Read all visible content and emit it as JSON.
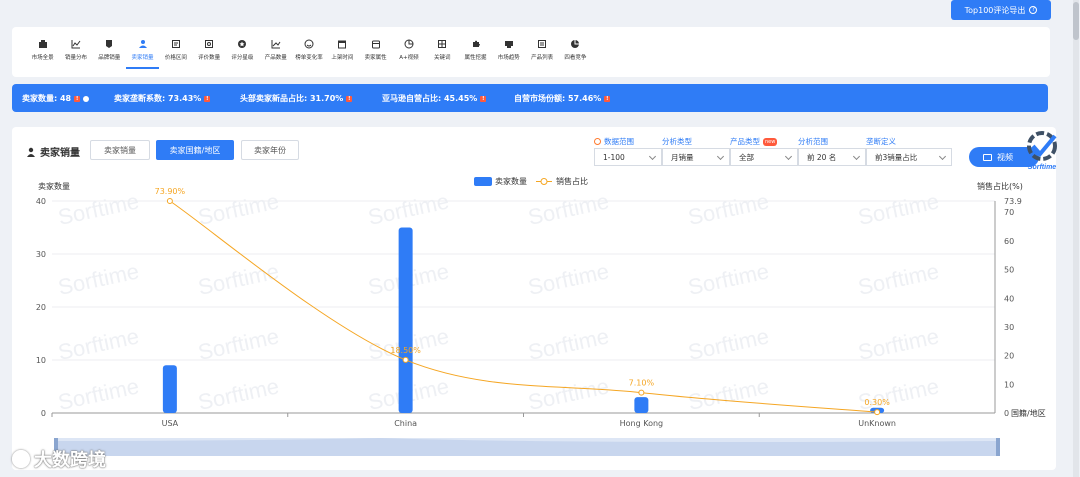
{
  "export_label": "Top100评论导出",
  "nav": [
    {
      "label": "市场全景",
      "icon": "market-icon"
    },
    {
      "label": "销量分布",
      "icon": "line-chart-icon"
    },
    {
      "label": "品牌销量",
      "icon": "brand-icon"
    },
    {
      "label": "卖家销量",
      "icon": "seller-icon",
      "active": true
    },
    {
      "label": "价格区间",
      "icon": "price-icon"
    },
    {
      "label": "评价数量",
      "icon": "review-icon"
    },
    {
      "label": "评分星级",
      "icon": "star-icon"
    },
    {
      "label": "产品数量",
      "icon": "trend-icon"
    },
    {
      "label": "榜单变化率",
      "icon": "smile-icon"
    },
    {
      "label": "上架时间",
      "icon": "calendar-icon"
    },
    {
      "label": "卖家属性",
      "icon": "store-icon"
    },
    {
      "label": "A+视频",
      "icon": "pie-icon"
    },
    {
      "label": "关键词",
      "icon": "keyword-icon"
    },
    {
      "label": "属性挖掘",
      "icon": "puzzle-icon"
    },
    {
      "label": "市场趋势",
      "icon": "trend-box-icon"
    },
    {
      "label": "产品列表",
      "icon": "list-icon"
    },
    {
      "label": "四看竞争",
      "icon": "compete-icon"
    }
  ],
  "stats": [
    {
      "text": "卖家数量: 48"
    },
    {
      "text": "卖家垄断系数: 73.43%"
    },
    {
      "text": "头部卖家新品占比: 31.70%"
    },
    {
      "text": "亚马逊自营占比: 45.45%"
    },
    {
      "text": "自营市场份额: 57.46%"
    }
  ],
  "panel": {
    "title": "卖家销量",
    "segments": [
      "卖家销量",
      "卖家国籍/地区",
      "卖家年份"
    ],
    "filters": [
      {
        "label": "数据范围",
        "value": "1-100"
      },
      {
        "label": "分析类型",
        "value": "月销量"
      },
      {
        "label": "产品类型",
        "value": "全部",
        "badge": "new"
      },
      {
        "label": "分析范围",
        "value": "前 20 名"
      },
      {
        "label": "垄断定义",
        "value": "前3销量占比"
      }
    ],
    "video_label": "视频",
    "logo_text": "Sorftime"
  },
  "watermark": "大数跨境",
  "watermark_bg": "Sorftime",
  "chart_data": {
    "type": "bar",
    "categories": [
      "USA",
      "China",
      "Hong Kong",
      "UnKnown"
    ],
    "x_axis_name": "国籍/地区",
    "series": [
      {
        "name": "卖家数量",
        "type": "bar",
        "axis": "left",
        "values": [
          9,
          35,
          3,
          1
        ],
        "color": "#2f7cf6"
      },
      {
        "name": "销售占比",
        "type": "line",
        "axis": "right",
        "values": [
          73.9,
          18.5,
          7.1,
          0.3
        ],
        "labels": [
          "73.90%",
          "18.50%",
          "7.10%",
          "0.30%"
        ],
        "color": "#f5a623"
      }
    ],
    "ylabel_left": "卖家数量",
    "ylabel_right": "销售占比(%)",
    "ylim_left": [
      0,
      40
    ],
    "yticks_left": [
      0,
      10,
      20,
      30,
      40
    ],
    "ylim_right": [
      0,
      73.9
    ],
    "yticks_right": [
      0,
      10,
      20,
      30,
      40,
      50,
      60,
      70,
      73.9
    ],
    "legend": "top-center",
    "grid": true
  }
}
